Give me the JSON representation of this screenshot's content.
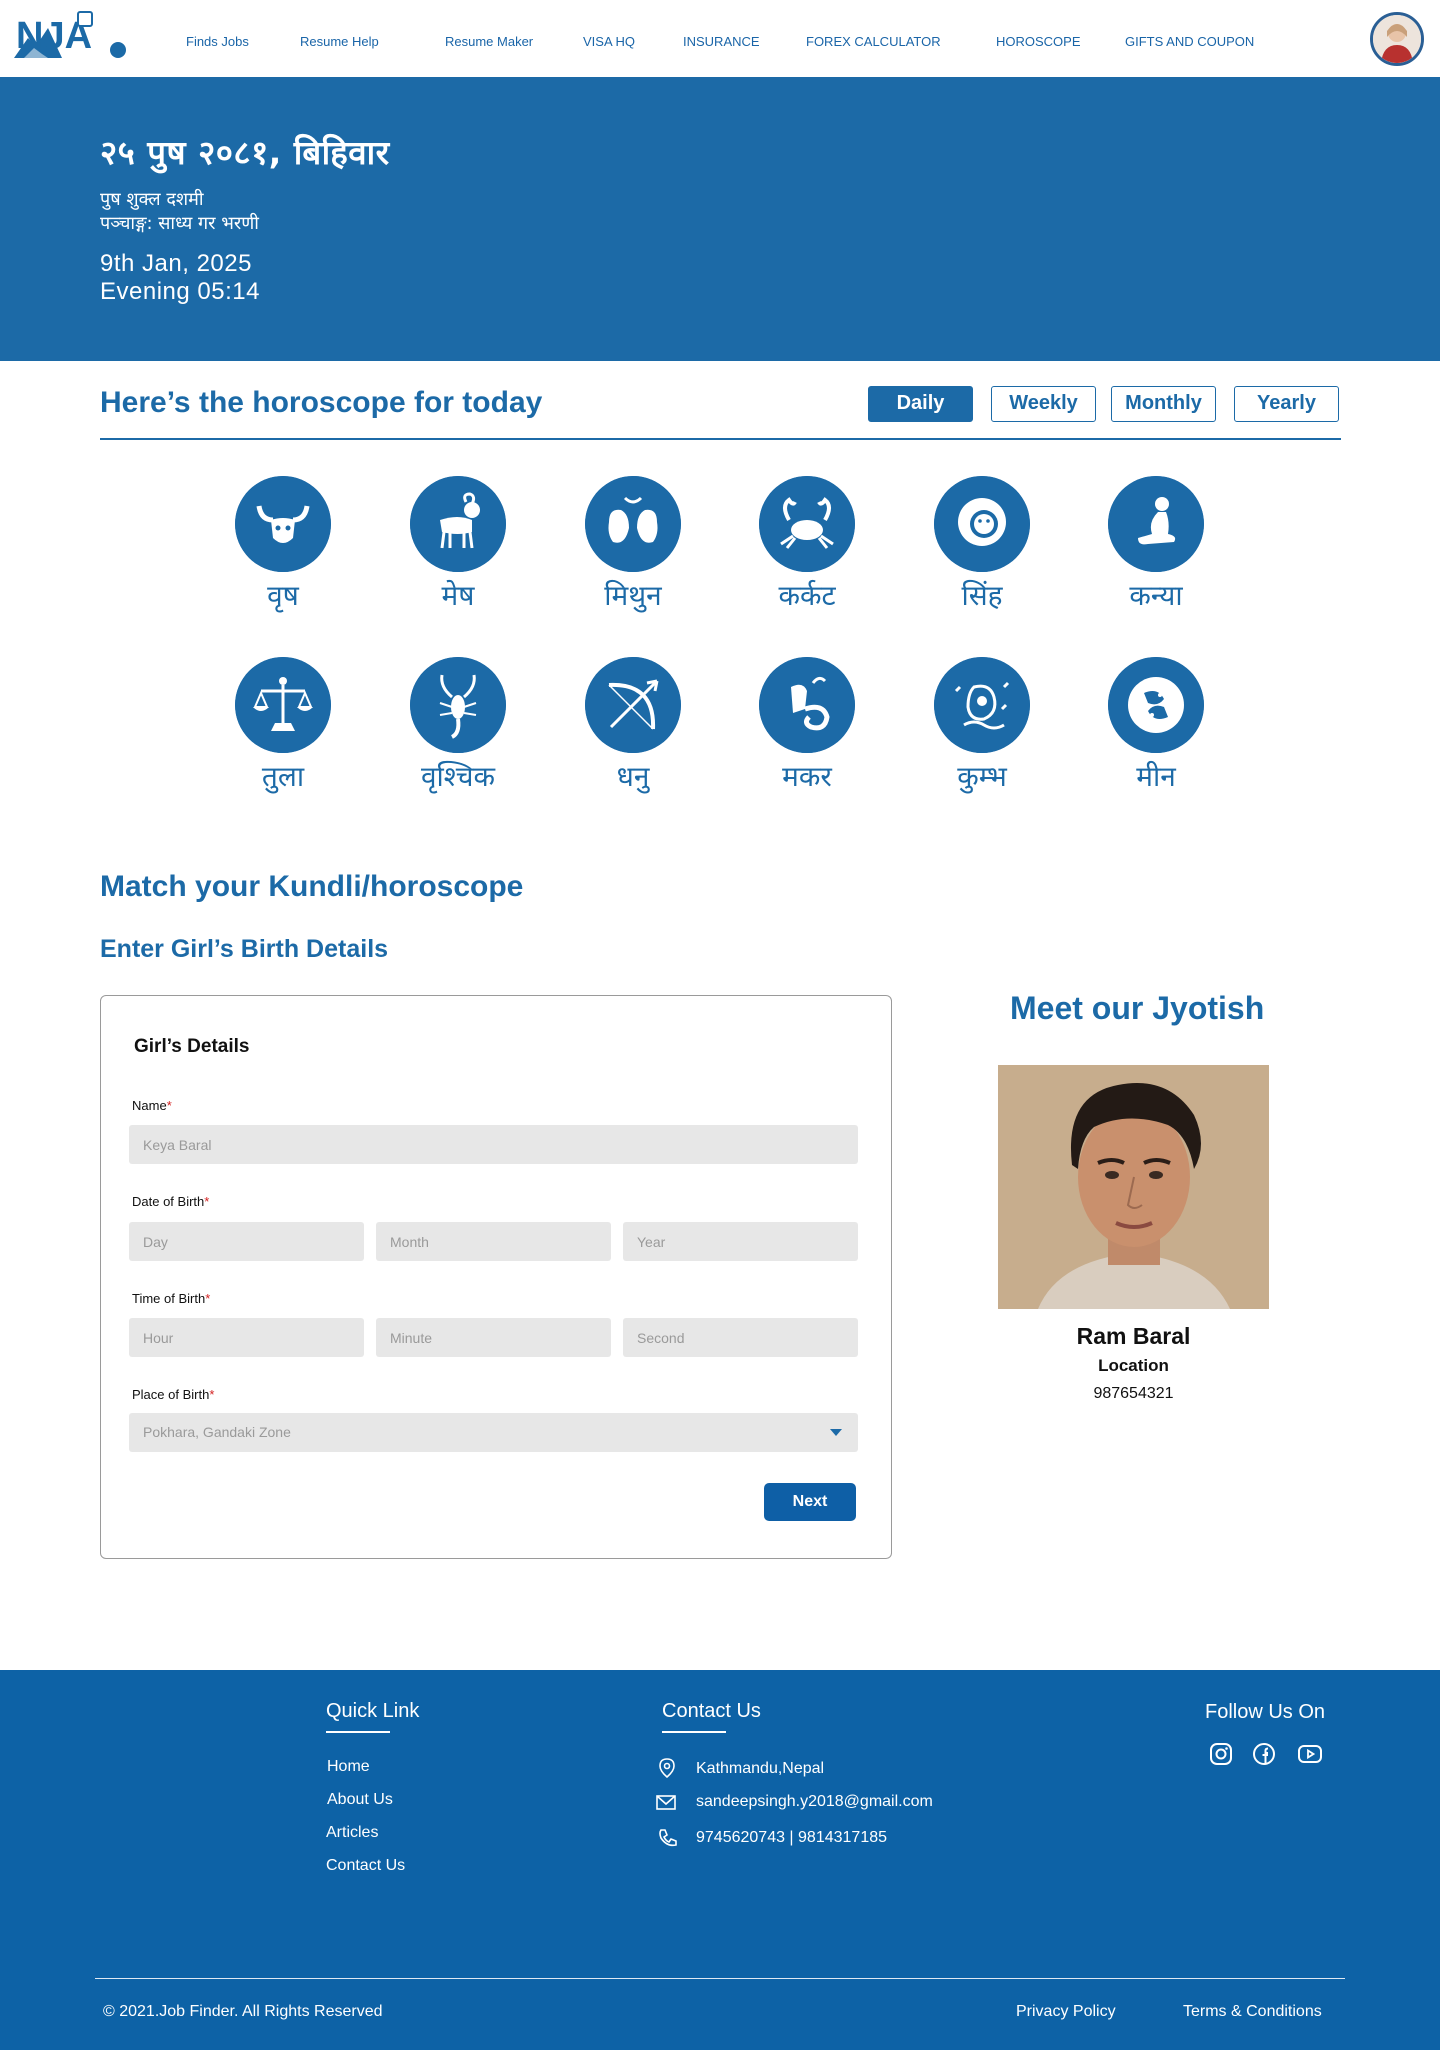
{
  "nav": {
    "logo_text": "NJA",
    "items": [
      "Finds Jobs",
      "Resume Help",
      "Resume Maker",
      "VISA HQ",
      "INSURANCE",
      "FOREX CALCULATOR",
      "HOROSCOPE",
      "GIFTS AND COUPON"
    ]
  },
  "hero": {
    "nepali_date": "२५ पुष २०८१, बिहिवार",
    "tithi": "पुष शुक्ल दशमी",
    "panchang": "पञ्चाङ्ग: साध्य गर भरणी",
    "english_date": "9th Jan, 2025",
    "time": "Evening 05:14"
  },
  "horoscope": {
    "title": "Here’s the horoscope for today",
    "periods": [
      "Daily",
      "Weekly",
      "Monthly",
      "Yearly"
    ],
    "active_period": "Daily",
    "signs": [
      "वृष",
      "मेष",
      "मिथुन",
      "कर्कट",
      "सिंह",
      "कन्या",
      "तुला",
      "वृश्चिक",
      "धनु",
      "मकर",
      "कुम्भ",
      "मीन"
    ]
  },
  "match": {
    "title": "Match your Kundli/horoscope",
    "subtitle": "Enter Girl’s Birth Details",
    "card_title": "Girl’s Details",
    "required_mark": "*",
    "name_label": "Name",
    "name_placeholder": "Keya Baral",
    "dob_label": "Date of Birth",
    "day_placeholder": "Day",
    "month_placeholder": "Month",
    "year_placeholder": "Year",
    "tob_label": "Time of Birth",
    "hour_placeholder": "Hour",
    "minute_placeholder": "Minute",
    "second_placeholder": "Second",
    "pob_label": "Place of Birth",
    "pob_value": "Pokhara, Gandaki Zone",
    "next_label": "Next"
  },
  "jyotish": {
    "title": "Meet our Jyotish",
    "name": "Ram Baral",
    "location": "Location",
    "phone": "987654321"
  },
  "footer": {
    "quick_link_title": "Quick Link",
    "quick_links": [
      "Home",
      "About Us",
      "Articles",
      "Contact Us"
    ],
    "contact_title": "Contact Us",
    "address": "Kathmandu,Nepal",
    "email": "sandeepsingh.y2018@gmail.com",
    "phones": "9745620743 | 9814317185",
    "follow_title": "Follow Us On",
    "copyright": "© 2021.Job Finder. All Rights Reserved",
    "privacy": "Privacy Policy",
    "terms": "Terms & Conditions"
  },
  "colors": {
    "brand_blue": "#1c6aa7",
    "footer_blue": "#0d62a6",
    "input_gray": "#e7e7e7",
    "required_red": "#d32020"
  }
}
